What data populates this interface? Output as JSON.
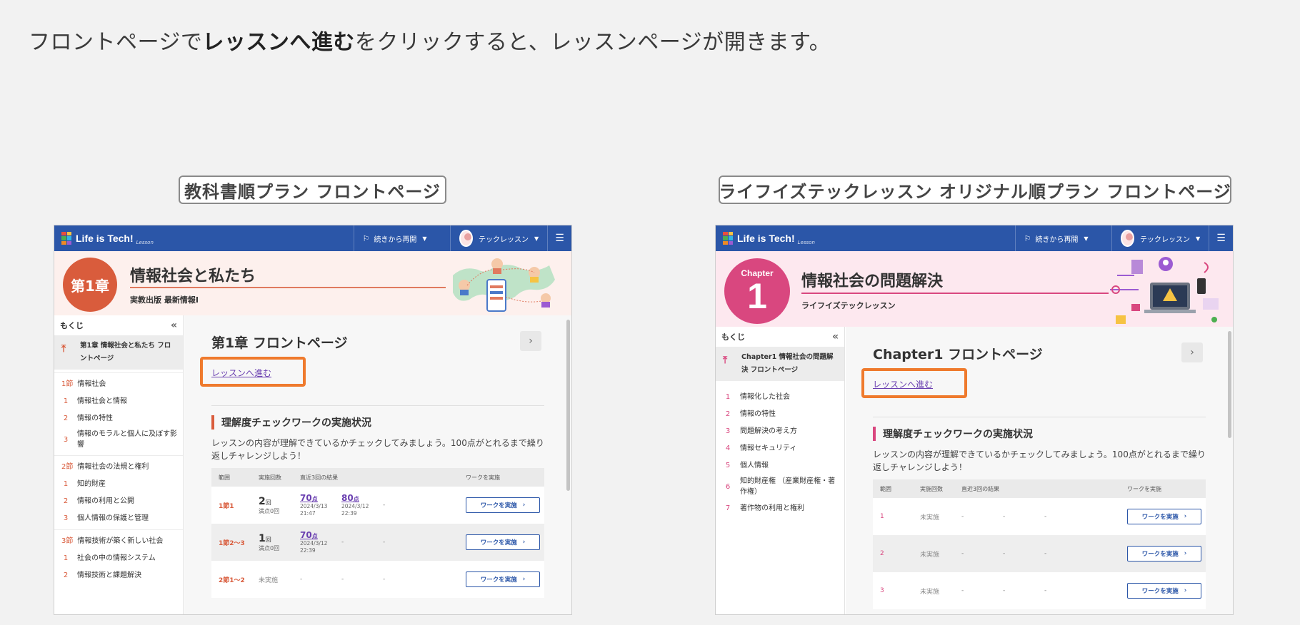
{
  "headline": {
    "before": "フロントページで",
    "emphasis": "レッスンへ進む",
    "after": "をクリックすると、レッスンページが開きます。"
  },
  "colors": {
    "topbar": "#2b56a8",
    "highlight": "#ef7a2d",
    "chapter_a": "#d95c3c",
    "chapter_b": "#d9477f",
    "link": "#6a3fb0"
  },
  "panelA": {
    "label": "教科書順プラン フロントページ",
    "topbar": {
      "logo": "Life is Tech!",
      "logo_sub": "Lesson",
      "resume": "続きから再開",
      "user": "テックレッスン",
      "resume_icon": "flag-icon",
      "menu_icon": "list-icon"
    },
    "banner": {
      "chapter": "第1章",
      "title": "情報社会と私たち",
      "subtitle": "実教出版 最新情報I"
    },
    "sidebar": {
      "title": "もくじ",
      "current": "第1章 情報社会と私たち フロントページ",
      "sections": [
        {
          "num": "1節",
          "label": "情報社会",
          "items": [
            {
              "num": "1",
              "label": "情報社会と情報"
            },
            {
              "num": "2",
              "label": "情報の特性"
            },
            {
              "num": "3",
              "label": "情報のモラルと個人に及ぼす影響"
            }
          ]
        },
        {
          "num": "2節",
          "label": "情報社会の法規と権利",
          "items": [
            {
              "num": "1",
              "label": "知的財産"
            },
            {
              "num": "2",
              "label": "情報の利用と公開"
            },
            {
              "num": "3",
              "label": "個人情報の保護と管理"
            }
          ]
        },
        {
          "num": "3節",
          "label": "情報技術が築く新しい社会",
          "items": [
            {
              "num": "1",
              "label": "社会の中の情報システム"
            },
            {
              "num": "2",
              "label": "情報技術と課題解決"
            }
          ]
        }
      ]
    },
    "main": {
      "page_title": "第1章 フロントページ",
      "lesson_link": "レッスンへ進む",
      "section_title": "理解度チェックワークの実施状況",
      "section_desc": "レッスンの内容が理解できているかチェックしてみましょう。100点がとれるまで繰り返しチャレンジしよう！",
      "table": {
        "headers": [
          "範囲",
          "実施回数",
          "直近3回の結果",
          "ワークを実施"
        ],
        "rows": [
          {
            "range": "1節1",
            "count": "2",
            "count_unit": "回",
            "full": "満点0回",
            "r1": "70",
            "r1_unit": "点",
            "r1_date": "2024/3/13",
            "r1_time": "21:47",
            "r2": "80",
            "r2_unit": "点",
            "r2_date": "2024/3/12",
            "r2_time": "22:39",
            "r3": "-",
            "button": "ワークを実施"
          },
          {
            "range": "1節2〜3",
            "count": "1",
            "count_unit": "回",
            "full": "満点0回",
            "r1": "70",
            "r1_unit": "点",
            "r1_date": "2024/3/12",
            "r1_time": "22:39",
            "r2": "-",
            "r3": "-",
            "button": "ワークを実施"
          },
          {
            "range": "2節1〜2",
            "status": "未実施",
            "r1": "-",
            "r2": "-",
            "r3": "-",
            "button": "ワークを実施"
          }
        ]
      }
    }
  },
  "panelB": {
    "label": "ライフイズテックレッスン オリジナル順プラン フロントページ",
    "topbar": {
      "logo": "Life is Tech!",
      "logo_sub": "Lesson",
      "resume": "続きから再開",
      "user": "テックレッスン",
      "resume_icon": "flag-icon",
      "menu_icon": "list-icon"
    },
    "banner": {
      "chapter_word": "Chapter",
      "chapter_num": "1",
      "title": "情報社会の問題解決",
      "subtitle": "ライフイズテックレッスン"
    },
    "sidebar": {
      "title": "もくじ",
      "current": "Chapter1 情報社会の問題解決 フロントページ",
      "items": [
        {
          "num": "1",
          "label": "情報化した社会"
        },
        {
          "num": "2",
          "label": "情報の特性"
        },
        {
          "num": "3",
          "label": "問題解決の考え方"
        },
        {
          "num": "4",
          "label": "情報セキュリティ"
        },
        {
          "num": "5",
          "label": "個人情報"
        },
        {
          "num": "6",
          "label": "知的財産権 （産業財産権・著作権）"
        },
        {
          "num": "7",
          "label": "著作物の利用と権利"
        }
      ]
    },
    "main": {
      "page_title": "Chapter1 フロントページ",
      "lesson_link": "レッスンへ進む",
      "section_title": "理解度チェックワークの実施状況",
      "section_desc": "レッスンの内容が理解できているかチェックしてみましょう。100点がとれるまで繰り返しチャレンジしよう！",
      "table": {
        "headers": [
          "範囲",
          "実施回数",
          "直近3回の結果",
          "ワークを実施"
        ],
        "rows": [
          {
            "range": "1",
            "status": "未実施",
            "r1": "-",
            "r2": "-",
            "r3": "-",
            "button": "ワークを実施"
          },
          {
            "range": "2",
            "status": "未実施",
            "r1": "-",
            "r2": "-",
            "r3": "-",
            "button": "ワークを実施"
          },
          {
            "range": "3",
            "status": "未実施",
            "r1": "-",
            "r2": "-",
            "r3": "-",
            "button": "ワークを実施"
          }
        ]
      }
    }
  }
}
